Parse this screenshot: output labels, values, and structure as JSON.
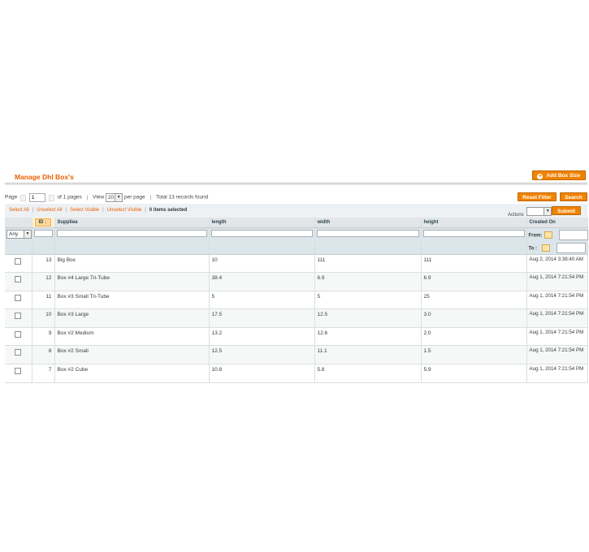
{
  "header": {
    "title": "Manage Dhl Box's",
    "add_button": "Add Box Size"
  },
  "pager": {
    "page_label": "Page",
    "page_value": "1",
    "of_pages": "of 1 pages",
    "view_label": "View",
    "view_value": "20",
    "per_page": "per page",
    "total": "Total 13 records found",
    "reset_filter": "Reset Filter",
    "search": "Search"
  },
  "massaction": {
    "select_all": "Select All",
    "unselect_all": "Unselect All",
    "select_visible": "Select Visible",
    "unselect_visible": "Unselect Visible",
    "selected": "0 items selected",
    "actions_label": "Actions",
    "submit": "Submit"
  },
  "columns": {
    "id": "ID",
    "supplies": "Suppliea",
    "length": "length",
    "width": "width",
    "height": "height",
    "created": "Created On"
  },
  "filters": {
    "any": "Any",
    "from": "From:",
    "to": "To :"
  },
  "rows": [
    {
      "id": "13",
      "supplies": "Big Box",
      "length": "10",
      "width": "111",
      "height": "111",
      "created": "Aug 2, 2014 3:38:40 AM"
    },
    {
      "id": "12",
      "supplies": "Box #4 Large Tri-Tube",
      "length": "38.4",
      "width": "6.9",
      "height": "6.9",
      "created": "Aug 1, 2014 7:21:54 PM"
    },
    {
      "id": "11",
      "supplies": "Box #3 Small Tri-Tube",
      "length": "5",
      "width": "5",
      "height": "25",
      "created": "Aug 1, 2014 7:21:54 PM"
    },
    {
      "id": "10",
      "supplies": "Box #3 Large",
      "length": "17.5",
      "width": "12.5",
      "height": "3.0",
      "created": "Aug 1, 2014 7:21:54 PM"
    },
    {
      "id": "9",
      "supplies": "Box #2 Medium",
      "length": "13.2",
      "width": "12.6",
      "height": "2.0",
      "created": "Aug 1, 2014 7:21:54 PM"
    },
    {
      "id": "8",
      "supplies": "Box #2 Small",
      "length": "12.5",
      "width": "11.1",
      "height": "1.5",
      "created": "Aug 1, 2014 7:21:54 PM"
    },
    {
      "id": "7",
      "supplies": "Box #2 Cube",
      "length": "10.8",
      "width": "5.8",
      "height": "5.9",
      "created": "Aug 1, 2014 7:21:54 PM"
    }
  ],
  "colors": {
    "accent": "#eb5e00",
    "button": "#f18200",
    "header_bg": "#e2e6e8",
    "filter_bg": "#dbe5ea"
  }
}
